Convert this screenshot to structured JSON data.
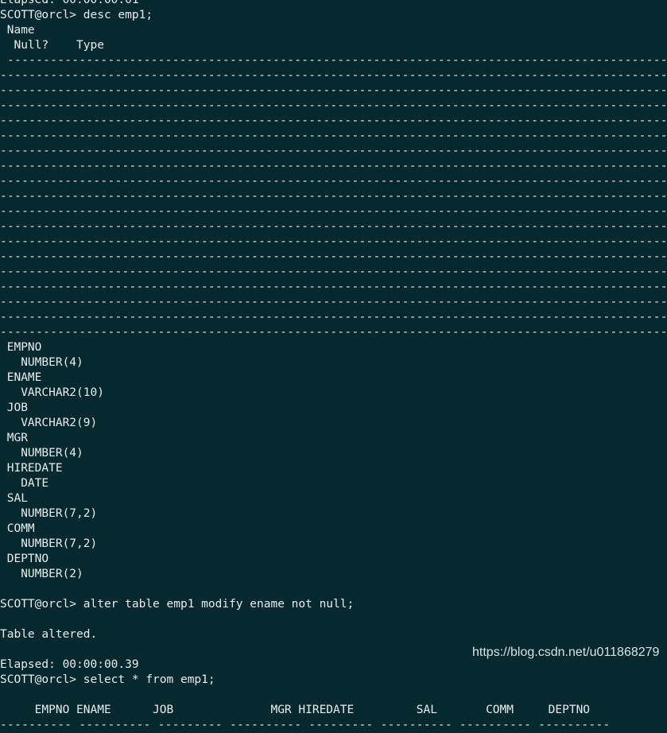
{
  "terminal": {
    "prompt": "SCOTT@orcl> ",
    "lines": [
      "Elapsed: 00:00:00.01",
      "SCOTT@orcl> desc emp1;",
      " Name",
      "  Null?    Type",
      " ----------------------------------------------------------------------------------------------------------------------------------------------------------------------",
      "-------------------------------------------------------------------------------------------------------------------------------------------------------------------------",
      "-------------------------------------------------------------------------------------------------------------------------------------------------------------------------",
      "-------------------------------------------------------------------------------------------------------------------------------------------------------------------------",
      "-------------------------------------------------------------------------------------------------------------------------------------------------------------------------",
      "-------------------------------------------------------------------------------------------------------------------------------------------------------------------------",
      "-------------------------------------------------------------------------------------------------------------------------------------------------------------------------",
      "-------------------------------------------------------------------------------------------------------------------------------------------------------------------------",
      "-------------------------------------------------------------------------------------------------------------------------------------------------------------------------",
      "-------------------------------------------------------------------------------------------------------------------------------------------------------------------------",
      "-------------------------------------------------------------------------------------------------------------------------------------------------------------------------",
      "-------------------------------------------------------------------------------------------------------------------------------------------------------------------------",
      "-------------------------------------------------------------------------------------------------------------------------------------------------------------------------",
      "-------------------------------------------------------------------------------------------------------------------------------------------------------------------------",
      "-------------------------------------------------------------------------------------------------------------------------------------------------------------------------",
      "-------------------------------------------------------------------------------------------------------------------------------------------------------------------------",
      "-------------------------------------------------------------------------------------------------------------------------------------------------------------------------",
      "-------------------------------------------------------------------------------------------------------------------------------------------------------------------------",
      "-------------------------------------------------------------------------------------------------------------------------------------------------------------------------",
      " EMPNO",
      "   NUMBER(4)",
      " ENAME",
      "   VARCHAR2(10)",
      " JOB",
      "   VARCHAR2(9)",
      " MGR",
      "   NUMBER(4)",
      " HIREDATE",
      "   DATE",
      " SAL",
      "   NUMBER(7,2)",
      " COMM",
      "   NUMBER(7,2)",
      " DEPTNO",
      "   NUMBER(2)",
      "",
      "SCOTT@orcl> alter table emp1 modify ename not null;",
      "",
      "Table altered.",
      "",
      "Elapsed: 00:00:00.39",
      "SCOTT@orcl> select * from emp1;",
      "",
      "     EMPNO ENAME      JOB              MGR HIREDATE         SAL       COMM     DEPTNO",
      "---------- ---------- --------- ---------- --------- ---------- ---------- ----------"
    ]
  },
  "watermark": "https://blog.csdn.net/u011868279",
  "colors": {
    "background": "#06282f",
    "text": "#e7eef0"
  }
}
